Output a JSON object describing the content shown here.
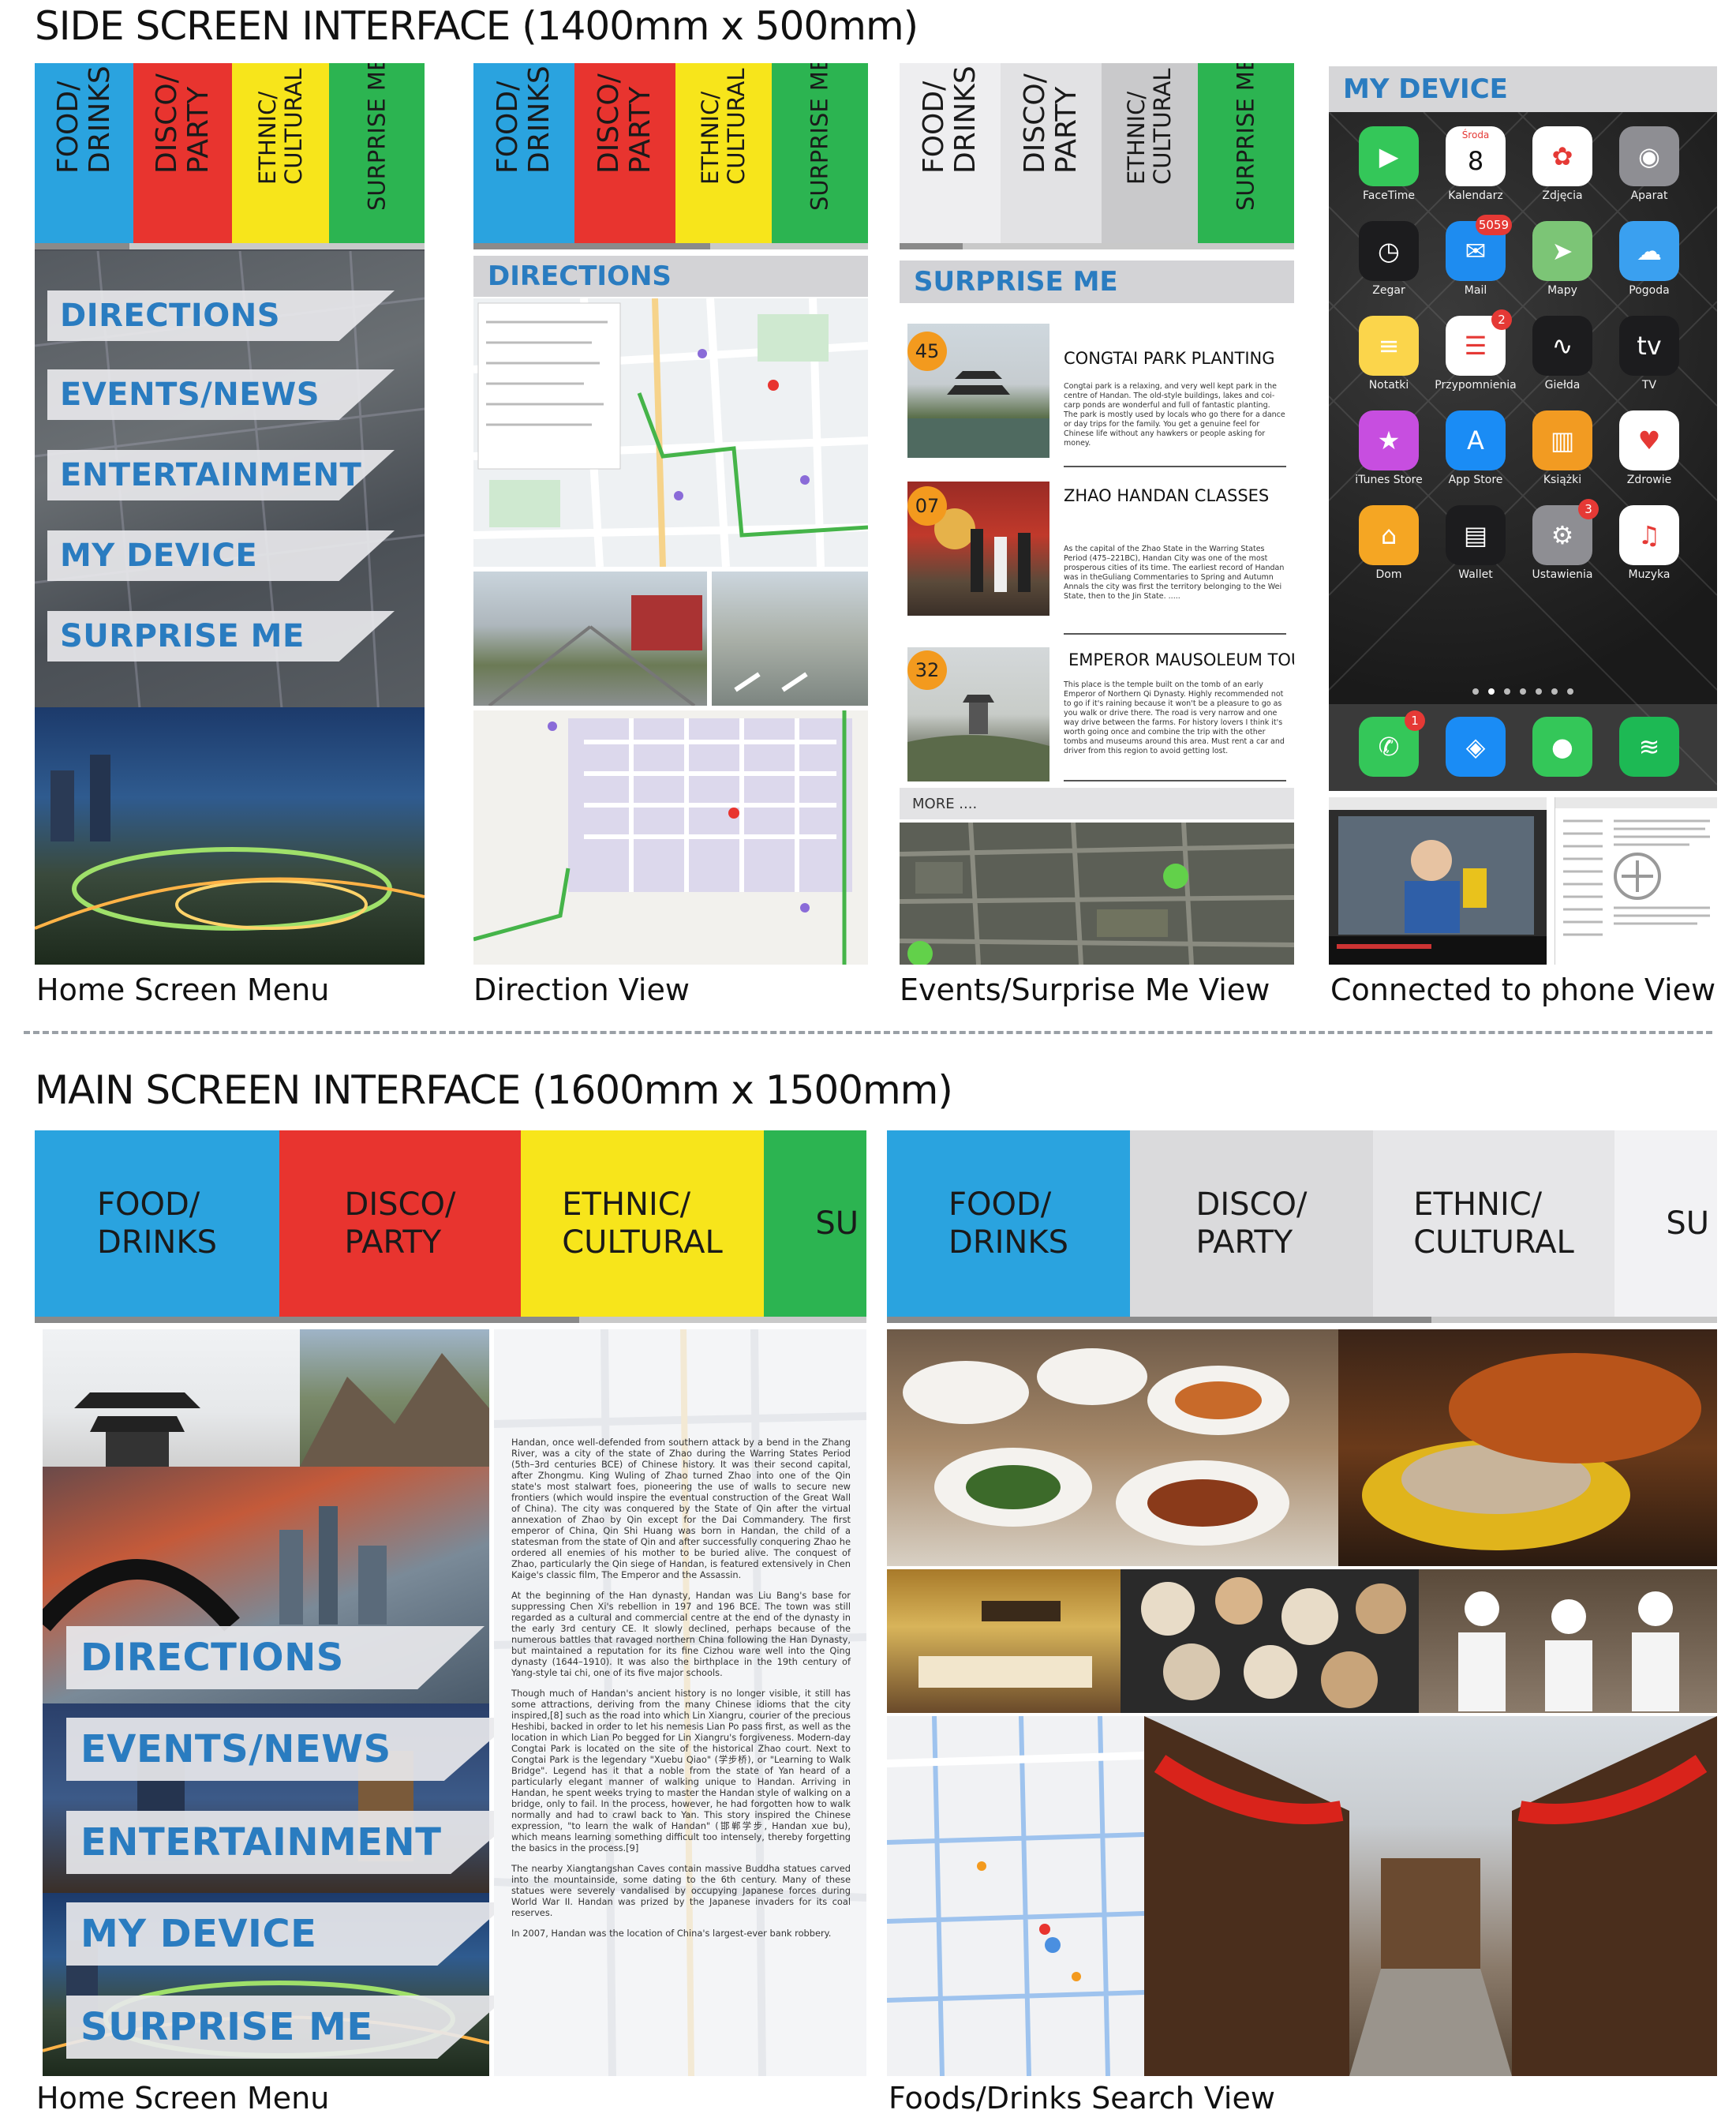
{
  "headings": {
    "side": "SIDE SCREEN INTERFACE (1400mm x 500mm)",
    "main": "MAIN SCREEN INTERFACE (1600mm x 1500mm)"
  },
  "colors": {
    "food": "#2aa3df",
    "disco": "#e8342f",
    "ethnic": "#f7e51b",
    "surprise": "#2cb451",
    "accent_blue": "#2a7cc0",
    "badge": "#f39a1e",
    "inactive": "#d6d6d8"
  },
  "categories": [
    {
      "label": "FOOD/\nDRINKS"
    },
    {
      "label": "DISCO/\nPARTY"
    },
    {
      "label": "ETHNIC/\nCULTURAL"
    },
    {
      "label": "SURPRISE ME"
    }
  ],
  "main_categories": [
    {
      "label": "FOOD/\nDRINKS"
    },
    {
      "label": "DISCO/\nPARTY"
    },
    {
      "label": "ETHNIC/\nCULTURAL"
    },
    {
      "label": "SU"
    }
  ],
  "menu": [
    "DIRECTIONS",
    "EVENTS/NEWS",
    "ENTERTAINMENT",
    "MY DEVICE",
    "SURPRISE ME"
  ],
  "panels": {
    "directions_header": "DIRECTIONS",
    "surprise_header": "SURPRISE ME",
    "device_header": "MY DEVICE",
    "more_label": "MORE ...."
  },
  "events": [
    {
      "badge": "45",
      "title": "CONGTAI PARK PLANTING",
      "body": "Congtai park is a relaxing, and very well kept park in the centre of Handan. The old-style buildings, lakes and coi-carp ponds are wonderful and full of fantastic planting. The park is mostly used by locals who go there for a dance or day trips for the family. You get a genuine feel for Chinese life without any hawkers or people asking for money."
    },
    {
      "badge": "07",
      "title": "ZHAO HANDAN CLASSES",
      "body": "As the capital of the Zhao State in the Warring States Period (475–221BC), Handan City was one of the most prosperous cities of its time. The earliest record of Handan was in theGuliang Commentaries to Spring and Autumn Annals the city was first the territory belonging to the Wei State, then to the Jin State. ....."
    },
    {
      "badge": "32",
      "title": "EMPEROR MAUSOLEUM TOUR",
      "body": "This place is the temple built on the tomb of an early Emperor of Northern Qi Dynasty. Highly recommended not to go if it's raining because it won't be a pleasure to go as you walk or drive there. The road is very narrow and one way drive between the farms. For history lovers I think it's worth going once and combine the trip with the other tombs and museums around this area. Must rent a car and driver from this region to avoid getting lost."
    }
  ],
  "apps": [
    {
      "name": "FaceTime",
      "glyph": "▶",
      "color": "#34c759"
    },
    {
      "name": "Kalendarz",
      "glyph": "8",
      "color": "#ffffff",
      "top": "Środa"
    },
    {
      "name": "Zdjęcia",
      "glyph": "✿",
      "color": "#ffffff"
    },
    {
      "name": "Aparat",
      "glyph": "◉",
      "color": "#8e8e93"
    },
    {
      "name": "Zegar",
      "glyph": "◷",
      "color": "#1c1c1e"
    },
    {
      "name": "Mail",
      "glyph": "✉",
      "color": "#1e8cf0",
      "badge": "5059"
    },
    {
      "name": "Mapy",
      "glyph": "➤",
      "color": "#7cc576"
    },
    {
      "name": "Pogoda",
      "glyph": "☁",
      "color": "#3aa0f0"
    },
    {
      "name": "Notatki",
      "glyph": "≡",
      "color": "#fbd54b"
    },
    {
      "name": "Przypomnienia",
      "glyph": "☰",
      "color": "#ffffff",
      "badge": "2"
    },
    {
      "name": "Giełda",
      "glyph": "∿",
      "color": "#1c1c1e"
    },
    {
      "name": "TV",
      "glyph": "tv",
      "color": "#1c1c1e"
    },
    {
      "name": "iTunes Store",
      "glyph": "★",
      "color": "#c74ee0"
    },
    {
      "name": "App Store",
      "glyph": "A",
      "color": "#1a8cf5"
    },
    {
      "name": "Książki",
      "glyph": "▥",
      "color": "#f29b22"
    },
    {
      "name": "Zdrowie",
      "glyph": "♥",
      "color": "#ffffff"
    },
    {
      "name": "Dom",
      "glyph": "⌂",
      "color": "#f5a623"
    },
    {
      "name": "Wallet",
      "glyph": "▤",
      "color": "#1c1c1e"
    },
    {
      "name": "Ustawienia",
      "glyph": "⚙",
      "color": "#8e8e93",
      "badge": "3"
    },
    {
      "name": "Muzyka",
      "glyph": "♫",
      "color": "#ffffff"
    }
  ],
  "dock": [
    {
      "name": "phone-app",
      "glyph": "✆",
      "color": "#34c759",
      "badge": "1"
    },
    {
      "name": "safari-app",
      "glyph": "◈",
      "color": "#1a8cf5"
    },
    {
      "name": "messages-app",
      "glyph": "●",
      "color": "#34c759"
    },
    {
      "name": "spotify-app",
      "glyph": "≋",
      "color": "#1db954"
    }
  ],
  "captions": {
    "home_menu": "Home Screen Menu",
    "direction_view": "Direction View",
    "events_view": "Events/Surprise Me View",
    "phone_view": "Connected to phone View",
    "main_home": "Home Screen Menu",
    "food_search": "Foods/Drinks Search View"
  },
  "history": [
    "Handan, once well-defended from southern attack by a bend in the Zhang River, was a city of the state of Zhao during the Warring States Period (5th–3rd centuries BCE) of Chinese history. It was their second capital, after Zhongmu. King Wuling of Zhao turned Zhao into one of the Qin state's most stalwart foes, pioneering the use of walls to secure new frontiers (which would inspire the eventual construction of the Great Wall of China). The city was conquered by the State of Qin after the virtual annexation of Zhao by Qin except for the Dai Commandery. The first emperor of China, Qin Shi Huang was born in Handan, the child of a statesman from the state of Qin and after successfully conquering Zhao he ordered all enemies of his mother to be buried alive. The conquest of Zhao, particularly the Qin siege of Handan, is featured extensively in Chen Kaige's classic film, The Emperor and the Assassin.",
    "At the beginning of the Han dynasty, Handan was Liu Bang's base for suppressing Chen Xi's rebellion in 197 and 196 BCE. The town was still regarded as a cultural and commercial centre at the end of the dynasty in the early 3rd century CE. It slowly declined, perhaps because of the numerous battles that ravaged northern China following the Han Dynasty, but maintained a reputation for its fine Cizhou ware well into the Qing dynasty (1644–1910). It was also the birthplace in the 19th century of Yang-style tai chi, one of its five major schools.",
    "Though much of Handan's ancient history is no longer visible, it still has some attractions, deriving from the many Chinese idioms that the city inspired,[8] such as the road into which Lin Xiangru, courier of the precious Heshibi, backed in order to let his nemesis Lian Po pass first, as well as the location in which Lian Po begged for Lin Xiangru's forgiveness. Modern-day Congtai Park is located on the site of the historical Zhao court. Next to Congtai Park is the legendary \"Xuebu Qiao\" (学步桥), or \"Learning to Walk Bridge\". Legend has it that a noble from the state of Yan heard of a particularly elegant manner of walking unique to Handan. Arriving in Handan, he spent weeks trying to master the Handan style of walking on a bridge, only to fail. In the process, however, he had forgotten how to walk normally and had to crawl back to Yan. This story inspired the Chinese expression, \"to learn the walk of Handan\" (邯郸学步, Handan xue bu), which means learning something difficult too intensely, thereby forgetting the basics in the process.[9]",
    "The nearby Xiangtangshan Caves contain massive Buddha statues carved into the mountainside, some dating to the 6th century. Many of these statues were severely vandalised by occupying Japanese forces during World War II. Handan was prized by the Japanese invaders for its coal reserves.",
    "In 2007, Handan was the location of China's largest-ever bank robbery."
  ]
}
